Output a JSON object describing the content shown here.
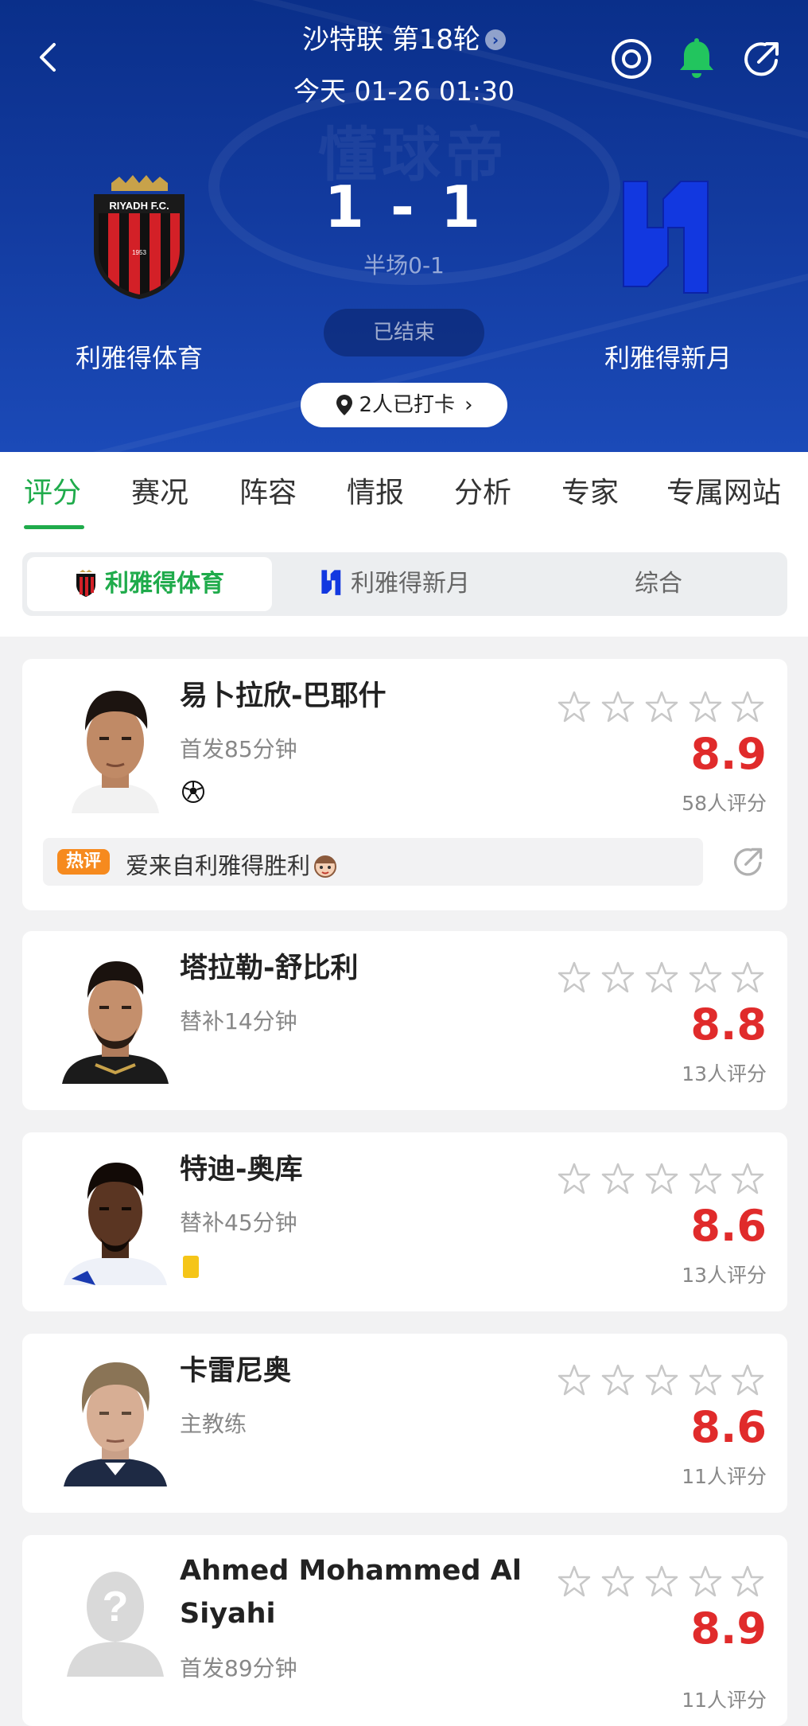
{
  "header": {
    "league_round": "沙特联 第18轮",
    "datetime": "今天 01-26 01:30",
    "home": {
      "name": "利雅得体育",
      "logo_text": "RIYADH F.C.",
      "logo_year": "1953"
    },
    "away": {
      "name": "利雅得新月"
    },
    "score": "1 - 1",
    "half_score": "半场0-1",
    "status": "已结束",
    "checkin": "2人已打卡",
    "watermark": "懂球帝",
    "colors": {
      "bg": "#123a9e",
      "accent": "#1fab4b",
      "bell": "#22c55e"
    }
  },
  "tabs": [
    "评分",
    "赛况",
    "阵容",
    "情报",
    "分析",
    "专家",
    "专属网站"
  ],
  "segments": [
    "利雅得体育",
    "利雅得新月",
    "综合"
  ],
  "players": [
    {
      "name": "易卜拉欣-巴耶什",
      "sub": "首发85分钟",
      "event": "goal",
      "rating": "8.9",
      "votes": "58人评分",
      "comment": {
        "tag": "热评",
        "text": "爱来自利雅得胜利"
      }
    },
    {
      "name": "塔拉勒-舒比利",
      "sub": "替补14分钟",
      "event": "",
      "rating": "8.8",
      "votes": "13人评分"
    },
    {
      "name": "特迪-奥库",
      "sub": "替补45分钟",
      "event": "yellow-card",
      "rating": "8.6",
      "votes": "13人评分"
    },
    {
      "name": "卡雷尼奥",
      "sub": "主教练",
      "event": "",
      "rating": "8.6",
      "votes": "11人评分"
    },
    {
      "name": "Ahmed Mohammed Al Siyahi",
      "sub": "首发89分钟",
      "event": "",
      "rating": "8.9",
      "votes": "11人评分"
    }
  ]
}
